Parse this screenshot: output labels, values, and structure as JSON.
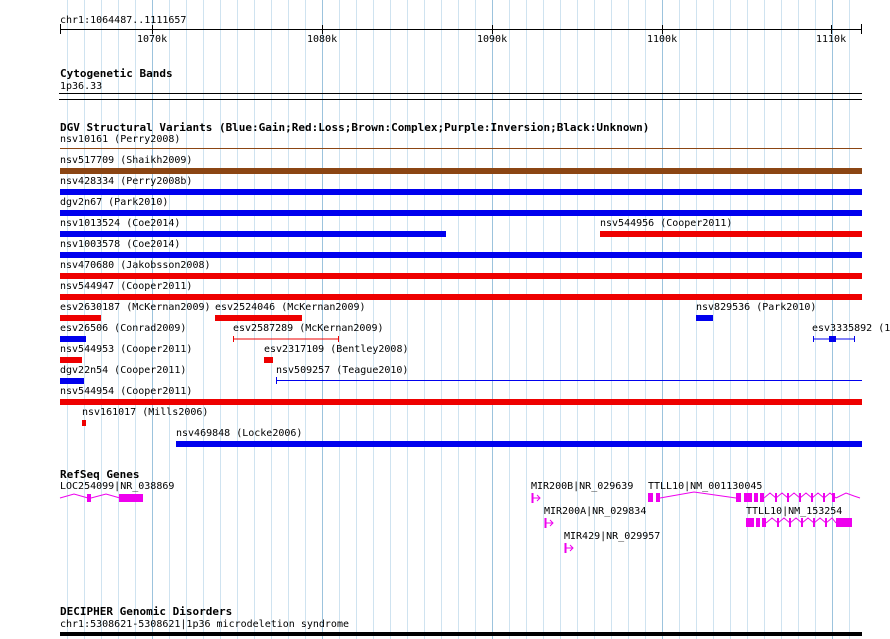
{
  "ruler": {
    "position": "chr1:1064487..1111657",
    "ticks": [
      "1070k",
      "1080k",
      "1090k",
      "1100k",
      "1110k"
    ]
  },
  "cytobands": {
    "title": "Cytogenetic Bands",
    "band": "1p36.33"
  },
  "dgv": {
    "title": "DGV Structural Variants (Blue:Gain;Red:Loss;Brown:Complex;Purple:Inversion;Black:Unknown)",
    "labels": {
      "v1": "nsv10161 (Perry2008)",
      "v2": "nsv517709 (Shaikh2009)",
      "v3": "nsv428334 (Perry2008b)",
      "v4": "dgv2n67 (Park2010)",
      "v5": "nsv1013524 (Coe2014)",
      "v6": "nsv544956 (Cooper2011)",
      "v7": "nsv1003578 (Coe2014)",
      "v8": "nsv470680 (Jakobsson2008)",
      "v9": "nsv544947 (Cooper2011)",
      "v10": "esv2630187 (McKernan2009)",
      "v11": "esv2524046 (McKernan2009)",
      "v12": "nsv829536 (Park2010)",
      "v13": "esv26506 (Conrad2009)",
      "v14": "esv2587289 (McKernan2009)",
      "v15": "esv3335892 (1",
      "v16": "nsv544953 (Cooper2011)",
      "v17": "esv2317109 (Bentley2008)",
      "v18": "dgv22n54 (Cooper2011)",
      "v19": "nsv509257 (Teague2010)",
      "v20": "nsv544954 (Cooper2011)",
      "v21": "nsv161017 (Mills2006)",
      "v22": "nsv469848 (Locke2006)"
    }
  },
  "refseq": {
    "title": "RefSeq Genes",
    "genes": {
      "g1": "LOC254099|NR_038869",
      "g2": "MIR200B|NR_029639",
      "g3": "TTLL10|NM_001130045",
      "g4": "MIR200A|NR_029834",
      "g5": "TTLL10|NM_153254",
      "g6": "MIR429|NR_029957"
    }
  },
  "decipher": {
    "title": "DECIPHER Genomic Disorders",
    "entry": "chr1:5308621-5308621|1p36 microdeletion syndrome"
  },
  "colors": {
    "gain": "#0000ee",
    "loss": "#ee0000",
    "complex": "#8b4513",
    "gene": "#ee00ee",
    "gridline": "#a9cce3"
  }
}
